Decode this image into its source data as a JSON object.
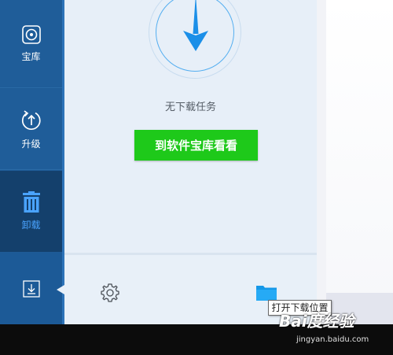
{
  "sidebar": {
    "items": [
      {
        "id": "store",
        "label": "宝库",
        "icon": "disc-icon"
      },
      {
        "id": "upgrade",
        "label": "升级",
        "icon": "upgrade-refresh-icon"
      },
      {
        "id": "uninstall",
        "label": "卸载",
        "icon": "trash-bin-icon"
      },
      {
        "id": "download",
        "label": "",
        "icon": "download-tray-icon"
      }
    ],
    "active": "download"
  },
  "main": {
    "status_text": "无下载任务",
    "store_link_label": "到软件宝库看看"
  },
  "bottom_bar": {
    "settings_icon": "gear-icon",
    "folder_icon": "folder-icon",
    "tooltip": "打开下载位置"
  },
  "watermark": {
    "mark": "Bai度经验",
    "url": "jingyan.baidu.com"
  },
  "colors": {
    "sidebar": "#1e5b96",
    "sidebar_active": "#14406c",
    "accent_blue": "#3aa0f0",
    "green_button": "#1ec91a",
    "panel": "#e7eff8"
  }
}
